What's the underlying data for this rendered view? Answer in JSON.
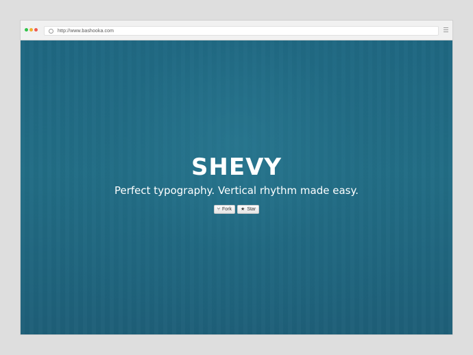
{
  "browser": {
    "url": "http://www.bashooka.com"
  },
  "hero": {
    "title": "SHEVY",
    "tagline": "Perfect typography. Vertical rhythm made easy.",
    "fork_label": "Fork",
    "star_label": "Star"
  },
  "icons": {
    "fork": "fork-icon",
    "star": "star-icon",
    "menu": "hamburger-menu-icon",
    "search": "search-icon"
  },
  "colors": {
    "background_top": "#1f6781",
    "background_bottom": "#1e5f78",
    "window_close": "#ef5a4f",
    "window_minimize": "#f3b02c",
    "window_maximize": "#2fc24a"
  }
}
